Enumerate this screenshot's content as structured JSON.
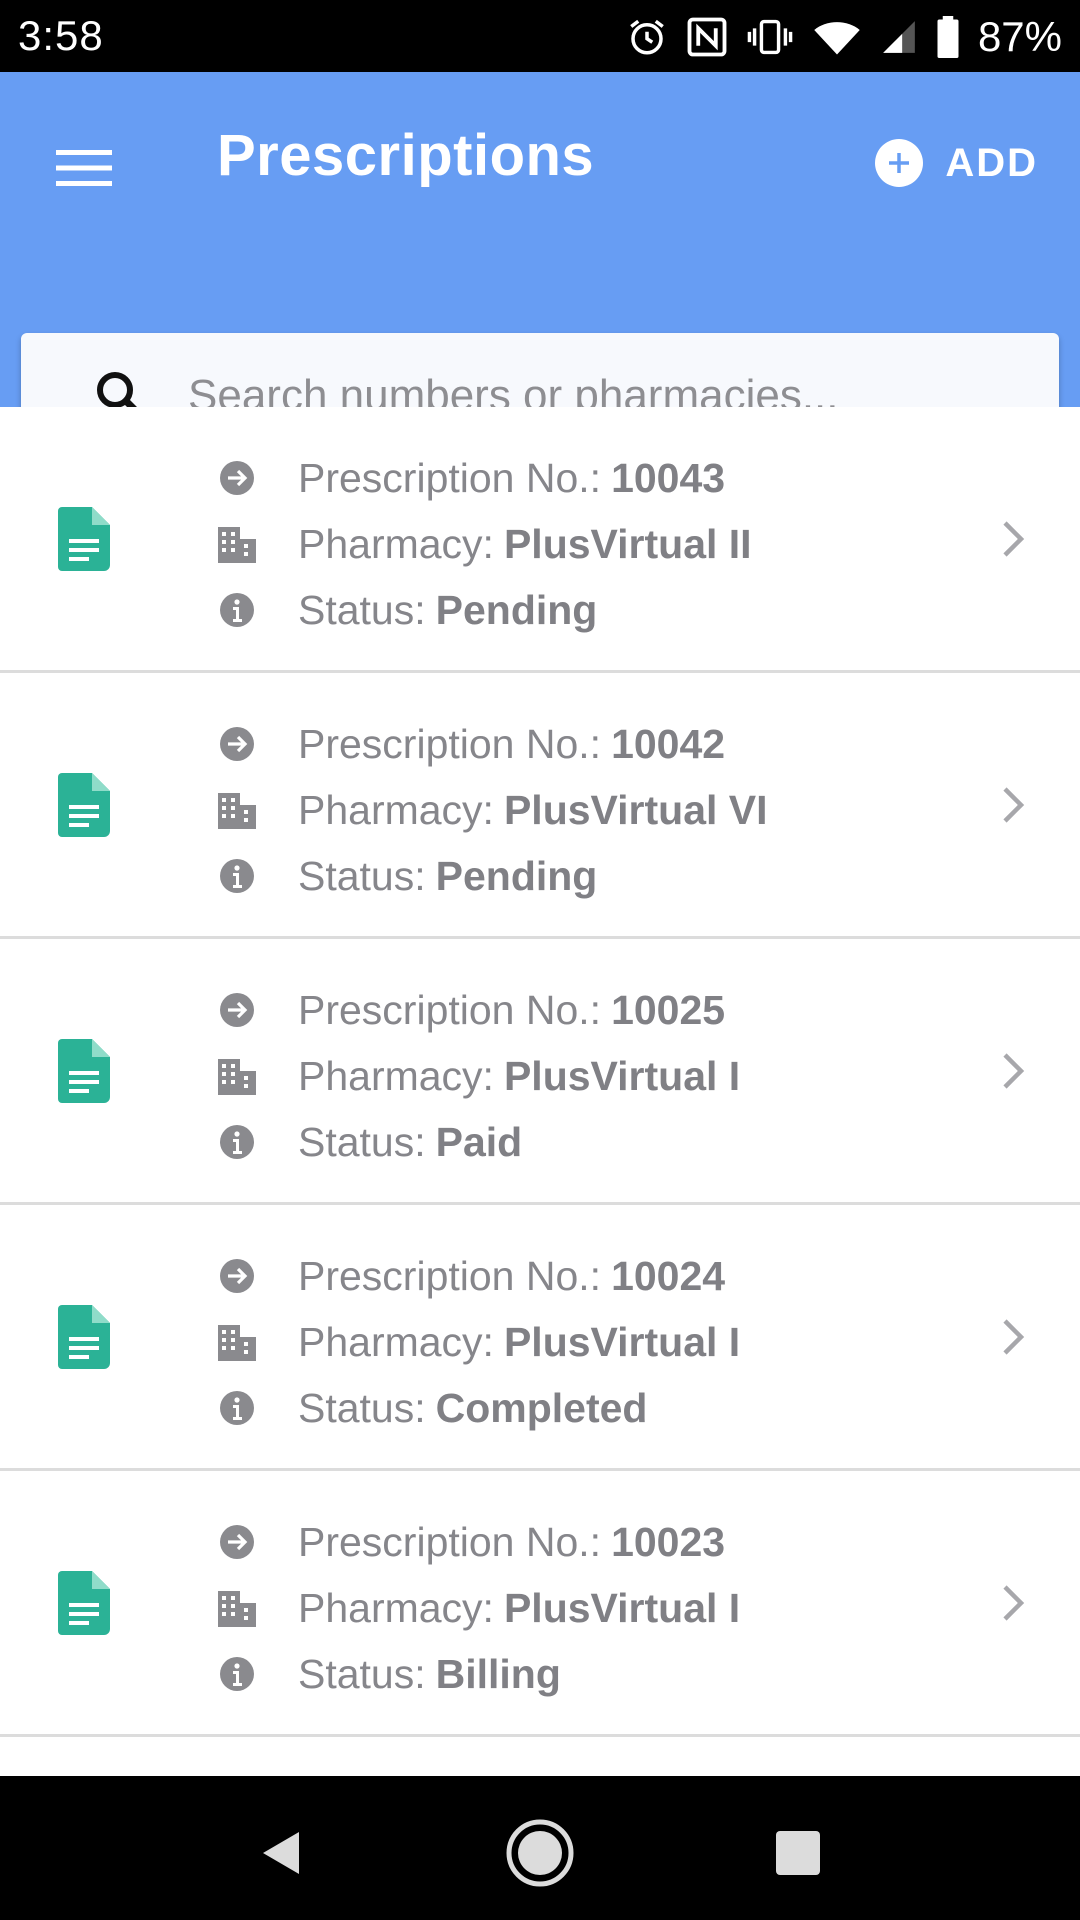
{
  "status_bar": {
    "time": "3:58",
    "battery_percent": "87%",
    "icons": [
      "alarm-icon",
      "nfc-icon",
      "vibrate-icon",
      "wifi-icon",
      "signal-icon",
      "battery-icon"
    ]
  },
  "app_bar": {
    "title": "Prescriptions",
    "add_label": "ADD",
    "background_color": "#679df3"
  },
  "search": {
    "placeholder": "Search numbers or pharmacies..."
  },
  "labels": {
    "prescription_no": "Prescription No.:",
    "pharmacy": "Pharmacy:",
    "status": "Status:"
  },
  "prescriptions": [
    {
      "number": "10043",
      "pharmacy": "PlusVirtual II",
      "status": "Pending"
    },
    {
      "number": "10042",
      "pharmacy": "PlusVirtual VI",
      "status": "Pending"
    },
    {
      "number": "10025",
      "pharmacy": "PlusVirtual I",
      "status": "Paid"
    },
    {
      "number": "10024",
      "pharmacy": "PlusVirtual I",
      "status": "Completed"
    },
    {
      "number": "10023",
      "pharmacy": "PlusVirtual I",
      "status": "Billing"
    }
  ],
  "colors": {
    "document_icon": "#2bb296",
    "row_icon": "#8a8a8e"
  },
  "nav_bar": {
    "buttons": [
      "back-icon",
      "home-icon",
      "recents-icon"
    ]
  }
}
